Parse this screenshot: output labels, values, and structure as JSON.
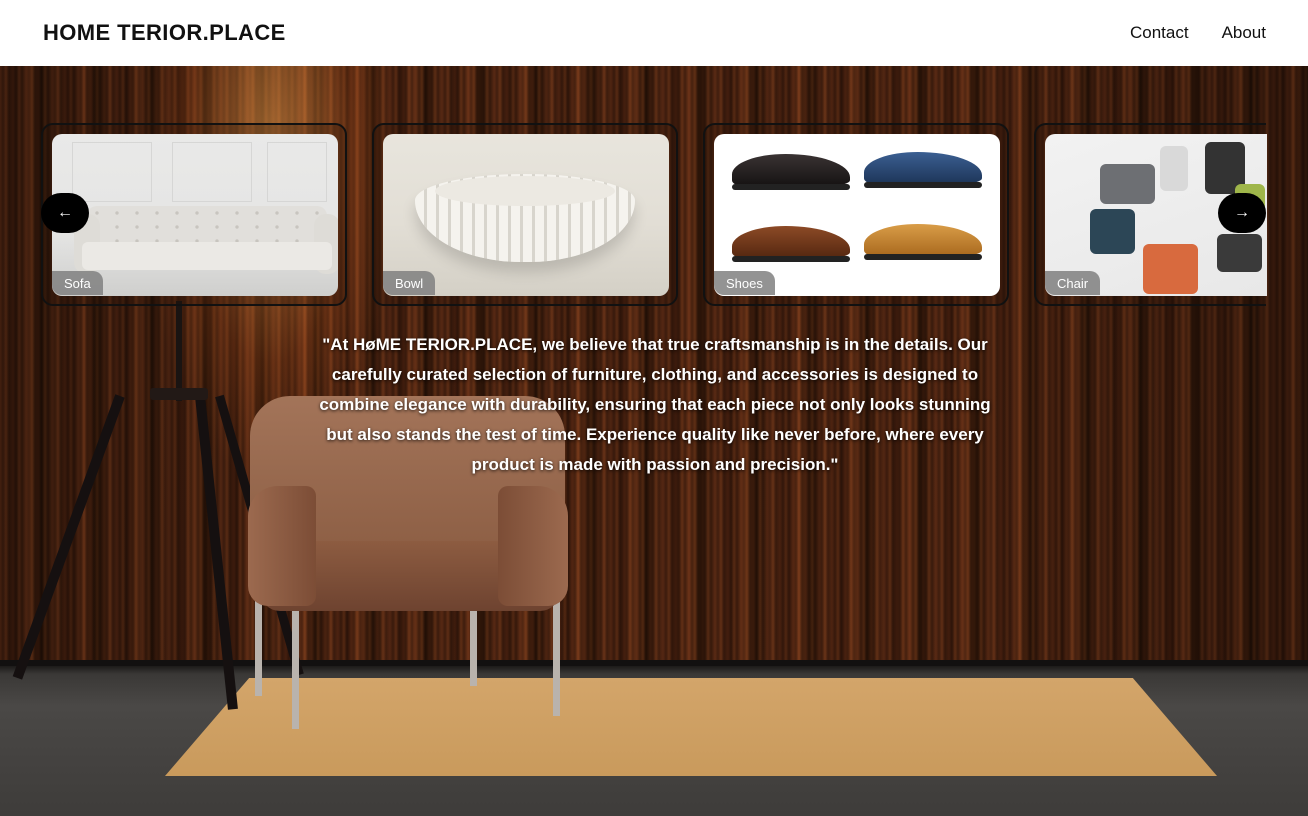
{
  "header": {
    "logo": "HOME TERIOR.PLACE",
    "nav": [
      "Contact",
      "About"
    ]
  },
  "carousel": {
    "prev_icon": "arrow-left-icon",
    "next_icon": "arrow-right-icon",
    "prev_glyph": "←",
    "next_glyph": "→",
    "items": [
      {
        "label": "Sofa"
      },
      {
        "label": "Bowl"
      },
      {
        "label": "Shoes"
      },
      {
        "label": "Chair"
      }
    ]
  },
  "quote": "\"At HøME TERIOR.PLACE, we believe that true craftsmanship is in the details. Our carefully curated selection of furniture, clothing, and accessories is designed to combine elegance with durability, ensuring that each piece not only looks stunning but also stands the test of time. Experience quality like never before, where every product is made with passion and precision.\"",
  "colors": {
    "accent": "#000000",
    "label_bg": "#808080",
    "text_on_image": "#ffffff"
  }
}
